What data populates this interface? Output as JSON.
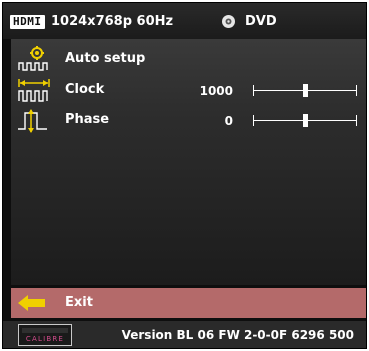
{
  "header": {
    "hdmi_badge": "HDMI",
    "resolution": "1024x768p 60Hz",
    "source_icon": "disc-icon",
    "source_label": "DVD"
  },
  "menu": {
    "items": [
      {
        "label": "Auto setup",
        "icon": "auto-setup-icon"
      },
      {
        "label": "Clock",
        "icon": "clock-icon",
        "value": "1000",
        "slider_level": 0.5
      },
      {
        "label": "Phase",
        "icon": "phase-icon",
        "value": "0",
        "slider_level": 0.5
      }
    ]
  },
  "exit": {
    "label": "Exit",
    "icon": "back-arrow-icon",
    "highlight_color": "#b46a6a"
  },
  "footer": {
    "logo_text": "CALIBRE",
    "version": "Version BL 06 FW 2-0-0F  6296 500"
  }
}
